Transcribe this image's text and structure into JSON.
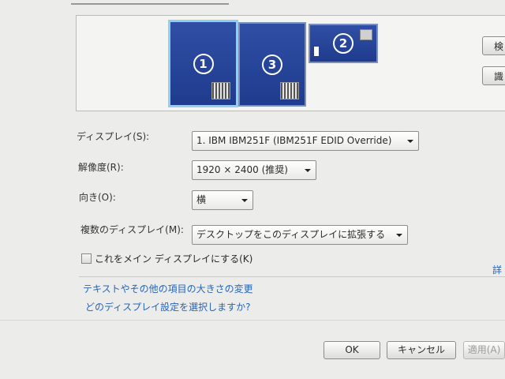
{
  "monitors": [
    {
      "id": "1",
      "label": "1"
    },
    {
      "id": "3",
      "label": "3"
    },
    {
      "id": "2",
      "label": "2"
    }
  ],
  "side_buttons": {
    "detect_label": "検",
    "identify_label": "識"
  },
  "form": {
    "display_label": "ディスプレイ(S):",
    "display_value": "1. IBM IBM251F (IBM251F EDID Override)",
    "resolution_label": "解像度(R):",
    "resolution_value": "1920 × 2400 (推奨)",
    "orientation_label": "向き(O):",
    "orientation_value": "横",
    "multi_label": "複数のディスプレイ(M):",
    "multi_value": "デスクトップをこのディスプレイに拡張する",
    "main_display_label": "これをメイン ディスプレイにする(K)"
  },
  "links": {
    "advanced": "詳",
    "text_size": "テキストやその他の項目の大きさの変更",
    "which_settings": "どのディスプレイ設定を選択しますか?"
  },
  "buttons": {
    "ok": "OK",
    "cancel": "キャンセル",
    "apply": "適用(A)"
  }
}
